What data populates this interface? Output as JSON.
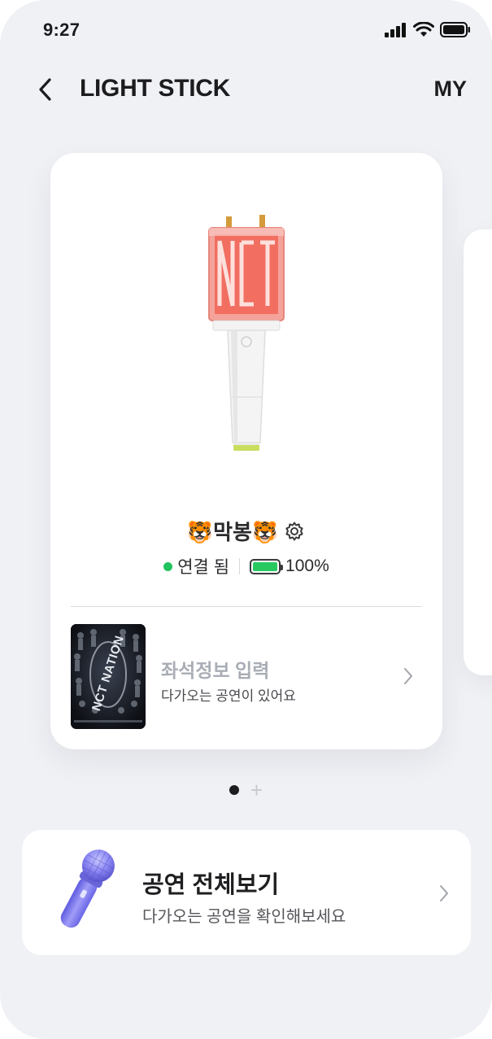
{
  "status_bar": {
    "time": "9:27",
    "icons": [
      "cellular-signal-icon",
      "wifi-icon",
      "battery-icon"
    ]
  },
  "header": {
    "back_icon": "chevron-left-icon",
    "title": "LIGHT STICK",
    "my_label": "MY"
  },
  "device_card": {
    "device_name": "🐯막봉🐯",
    "settings_icon": "gear-icon",
    "connection_status": "연결 됨",
    "battery_level": "100%",
    "battery_fraction": 1.0,
    "concert": {
      "seat_title": "좌석정보 입력",
      "seat_subtitle": "다가오는 공연이 있어요",
      "poster_text": "NCT NATION",
      "chevron_icon": "chevron-right-icon"
    }
  },
  "pager": {
    "active_index": 0,
    "add_label": "+"
  },
  "all_concerts": {
    "title": "공연 전체보기",
    "subtitle": "다가오는 공연을 확인해보세요",
    "icon": "microphone-icon",
    "chevron_icon": "chevron-right-icon"
  },
  "colors": {
    "background": "#f0f1f5",
    "card": "#ffffff",
    "connected_green": "#21c35c",
    "battery_green": "#28c961",
    "lightstick_red": "#f16b5e",
    "microphone_purple": "#7f7cf0"
  }
}
